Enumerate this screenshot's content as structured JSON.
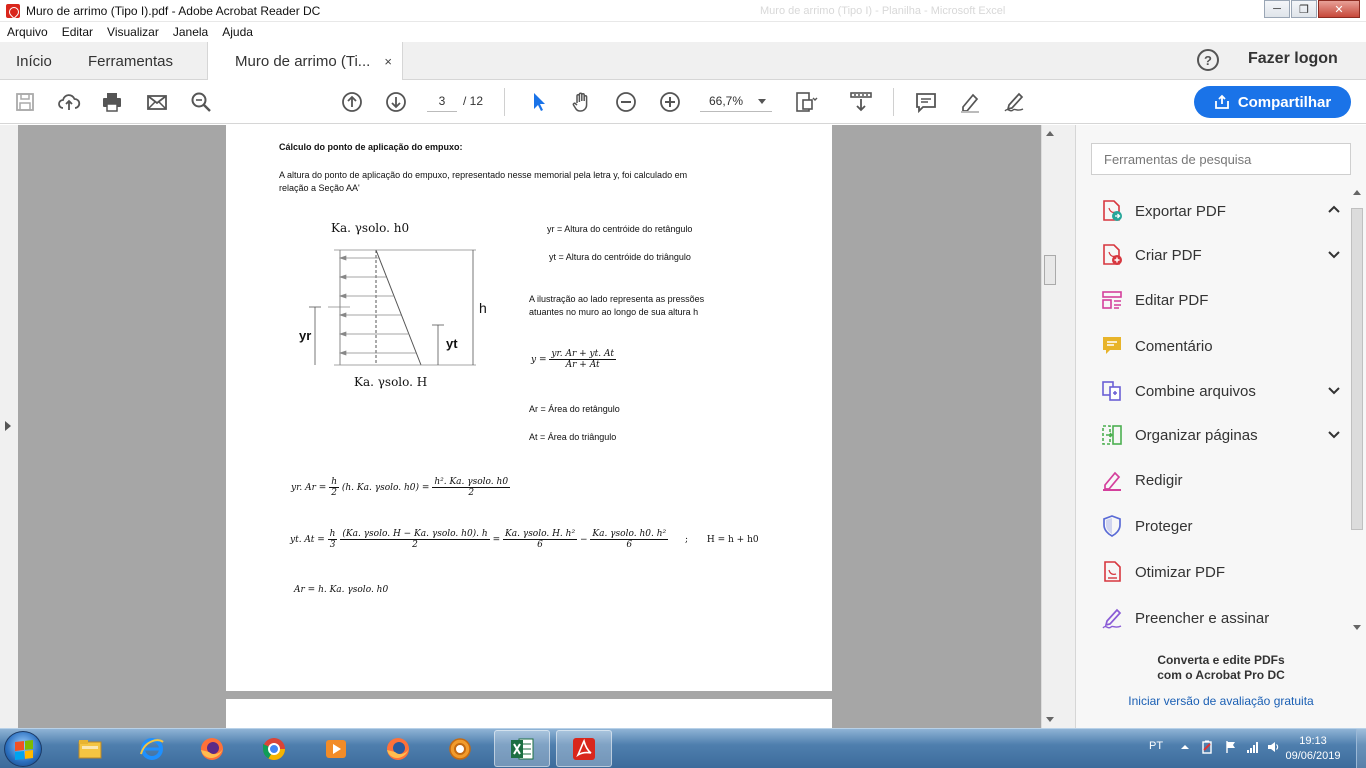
{
  "window": {
    "title": "Muro de arrimo (Tipo I).pdf - Adobe Acrobat Reader DC",
    "ghost_title": "Muro de arrimo (Tipo I) - Planilha - Microsoft Excel"
  },
  "menu": [
    "Arquivo",
    "Editar",
    "Visualizar",
    "Janela",
    "Ajuda"
  ],
  "tabs": {
    "home": "Início",
    "tools": "Ferramentas",
    "document": "Muro de arrimo (Ti...",
    "close": "×"
  },
  "header": {
    "help": "?",
    "logon": "Fazer logon"
  },
  "toolbar": {
    "page_current": "3",
    "page_total": "/ 12",
    "zoom": "66,7%",
    "share_label": "Compartilhar"
  },
  "document": {
    "heading": "Cálculo do ponto de aplicação do empuxo:",
    "intro_line1": "A altura do ponto de aplicação do empuxo, representado nesse memorial pela letra y, foi calculado em",
    "intro_line2": "relação a Seção AA'",
    "diagram": {
      "top_label": "Ka. γsolo. h0",
      "bottom_label": "Ka. γsolo. H",
      "h_label": "h",
      "yr_label": "yr",
      "yt_label": "yt"
    },
    "legend_yr": "yr = Altura do centróide do retângulo",
    "legend_yt": "yt = Altura do centróide do triângulo",
    "desc_line1": "A ilustração ao lado representa as pressões",
    "desc_line2": "atuantes no muro ao longo de sua altura h",
    "eq_y_lhs": "y =",
    "eq_y_num": "yr. Ar + yt. At",
    "eq_y_den": "Ar + At",
    "ar_def": "Ar = Área do retângulo",
    "at_def": "At = Área do triângulo",
    "eq1_lhs": "yr. Ar =",
    "eq1_f1_num": "h",
    "eq1_f1_den": "2",
    "eq1_mid": "(h. Ka. γsolo. h0) =",
    "eq1_f2_num": "h². Ka. γsolo. h0",
    "eq1_f2_den": "2",
    "eq2_lhs": "yt. At =",
    "eq2_f1_num": "h",
    "eq2_f1_den": "3",
    "eq2_f2_num": "(Ka. γsolo. H − Ka. γsolo. h0). h",
    "eq2_f2_den": "2",
    "eq2_eq": "=",
    "eq2_f3_num": "Ka. γsolo. H. h²",
    "eq2_f3_den": "6",
    "eq2_minus": "−",
    "eq2_f4_num": "Ka. γsolo. h0. h²",
    "eq2_f4_den": "6",
    "eq2_sep": ";",
    "eq2_H": "H = h + h0",
    "eq3": "Ar = h. Ka. γsolo. h0"
  },
  "right_pane": {
    "search_placeholder": "Ferramentas de pesquisa",
    "items": [
      {
        "label": "Exportar PDF",
        "color": "#d7373f"
      },
      {
        "label": "Criar PDF",
        "color": "#d7373f"
      },
      {
        "label": "Editar PDF",
        "color": "#d43f9c"
      },
      {
        "label": "Comentário",
        "color": "#e8b42a"
      },
      {
        "label": "Combine arquivos",
        "color": "#6b5fd6"
      },
      {
        "label": "Organizar páginas",
        "color": "#4caf50"
      },
      {
        "label": "Redigir",
        "color": "#d43f9c"
      },
      {
        "label": "Proteger",
        "color": "#5a6bd6"
      },
      {
        "label": "Otimizar PDF",
        "color": "#d7373f"
      },
      {
        "label": "Preencher e assinar",
        "color": "#8a5cd6"
      }
    ],
    "promo_line1": "Converta e edite PDFs",
    "promo_line2": "com o Acrobat Pro DC",
    "promo_link": "Iniciar versão de avaliação gratuita"
  },
  "taskbar": {
    "language": "PT",
    "time": "19:13",
    "date": "09/06/2019"
  },
  "colors": {
    "accent": "#1a73e8",
    "doc_bg": "#a6a6a6"
  }
}
